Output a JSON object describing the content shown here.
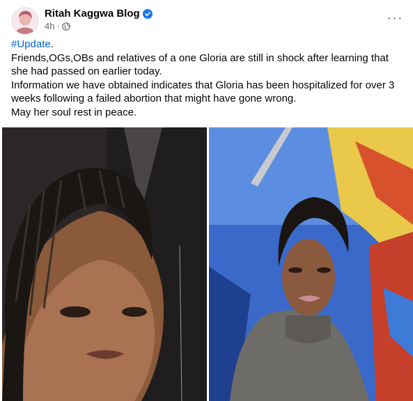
{
  "post": {
    "author": "Ritah Kaggwa Blog",
    "time": "4h",
    "more_label": "···",
    "hashtag": "#Update",
    "hashtag_suffix": ".",
    "paragraphs": [
      "Friends,OGs,OBs and relatives of a one Gloria are still in shock after learning that she had passed on earlier today.",
      "Information we have obtained indicates that Gloria has been hospitalized for over 3 weeks following a failed abortion that might have gone wrong.",
      "May her soul rest in peace."
    ]
  },
  "icons": {
    "verified": "verified-badge-icon",
    "audience": "globe-icon",
    "more": "more-options-icon"
  },
  "colors": {
    "link": "#0064d1",
    "verified": "#1877f2",
    "secondary_text": "#65676b"
  }
}
